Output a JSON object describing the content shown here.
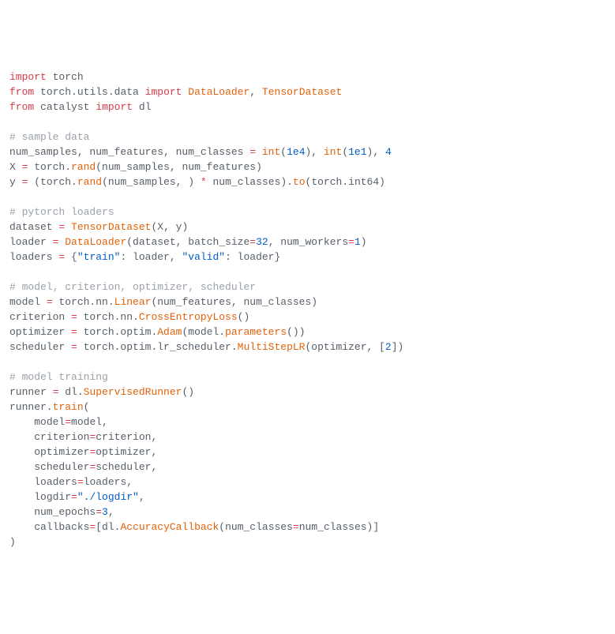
{
  "code": {
    "l1": {
      "import": "import",
      "sp": " ",
      "torch": "torch"
    },
    "l2": {
      "from": "from",
      "sp1": " ",
      "mod": "torch.utils.data",
      "sp2": " ",
      "import": "import",
      "sp3": " ",
      "a": "DataLoader",
      "c": ", ",
      "b": "TensorDataset"
    },
    "l3": {
      "from": "from",
      "sp1": " ",
      "mod": "catalyst",
      "sp2": " ",
      "import": "import",
      "sp3": " ",
      "a": "dl"
    },
    "blank1": "",
    "l4": {
      "c": "# sample data"
    },
    "l5": {
      "pre": "num_samples, num_features, num_classes ",
      "eq": "=",
      "sp": " ",
      "int1": "int",
      "p1": "(",
      "n1": "1e4",
      "p2": "), ",
      "int2": "int",
      "p3": "(",
      "n2": "1e1",
      "p4": "), ",
      "n3": "4"
    },
    "l6": {
      "x": "X ",
      "eq": "=",
      "txt": " torch.",
      "rand": "rand",
      "args": "(num_samples, num_features)"
    },
    "l7": {
      "y": "y ",
      "eq": "=",
      "txt": " (torch.",
      "rand": "rand",
      "mid": "(num_samples, ) ",
      "star": "*",
      "mid2": " num_classes).",
      "to": "to",
      "p1": "(torch.int64)"
    },
    "blank2": "",
    "l8": {
      "c": "# pytorch loaders"
    },
    "l9": {
      "pre": "dataset ",
      "eq": "=",
      "sp": " ",
      "fn": "TensorDataset",
      "args": "(X, y)"
    },
    "l10": {
      "pre": "loader ",
      "eq": "=",
      "sp": " ",
      "fn": "DataLoader",
      "p1": "(dataset, batch_size",
      "eq2": "=",
      "n1": "32",
      "c": ", num_workers",
      "eq3": "=",
      "n2": "1",
      "p2": ")"
    },
    "l11": {
      "pre": "loaders ",
      "eq": "=",
      "txt": " {",
      "s1": "\"train\"",
      "c1": ": loader, ",
      "s2": "\"valid\"",
      "c2": ": loader}"
    },
    "blank3": "",
    "l12": {
      "c": "# model, criterion, optimizer, scheduler"
    },
    "l13": {
      "pre": "model ",
      "eq": "=",
      "txt": " torch.nn.",
      "fn": "Linear",
      "args": "(num_features, num_classes)"
    },
    "l14": {
      "pre": "criterion ",
      "eq": "=",
      "txt": " torch.nn.",
      "fn": "CrossEntropyLoss",
      "args": "()"
    },
    "l15": {
      "pre": "optimizer ",
      "eq": "=",
      "txt": " torch.optim.",
      "fn": "Adam",
      "p1": "(model.",
      "fn2": "parameters",
      "p2": "())"
    },
    "l16": {
      "pre": "scheduler ",
      "eq": "=",
      "txt": " torch.optim.lr_scheduler.",
      "fn": "MultiStepLR",
      "p1": "(optimizer, [",
      "n": "2",
      "p2": "])"
    },
    "blank4": "",
    "l17": {
      "c": "# model training"
    },
    "l18": {
      "pre": "runner ",
      "eq": "=",
      "txt": " dl.",
      "fn": "SupervisedRunner",
      "args": "()"
    },
    "l19": {
      "pre": "runner.",
      "fn": "train",
      "p": "("
    },
    "l20": {
      "indent": "    ",
      "k": "model",
      "eq": "=",
      "v": "model,"
    },
    "l21": {
      "indent": "    ",
      "k": "criterion",
      "eq": "=",
      "v": "criterion,"
    },
    "l22": {
      "indent": "    ",
      "k": "optimizer",
      "eq": "=",
      "v": "optimizer,"
    },
    "l23": {
      "indent": "    ",
      "k": "scheduler",
      "eq": "=",
      "v": "scheduler,"
    },
    "l24": {
      "indent": "    ",
      "k": "loaders",
      "eq": "=",
      "v": "loaders,"
    },
    "l25": {
      "indent": "    ",
      "k": "logdir",
      "eq": "=",
      "v": "\"./logdir\"",
      "c": ","
    },
    "l26": {
      "indent": "    ",
      "k": "num_epochs",
      "eq": "=",
      "v": "3",
      "c": ","
    },
    "l27": {
      "indent": "    ",
      "k": "callbacks",
      "eq": "=",
      "b1": "[dl.",
      "fn": "AccuracyCallback",
      "p1": "(num_classes",
      "eq2": "=",
      "v": "num_classes)]"
    },
    "l28": {
      "p": ")"
    }
  }
}
